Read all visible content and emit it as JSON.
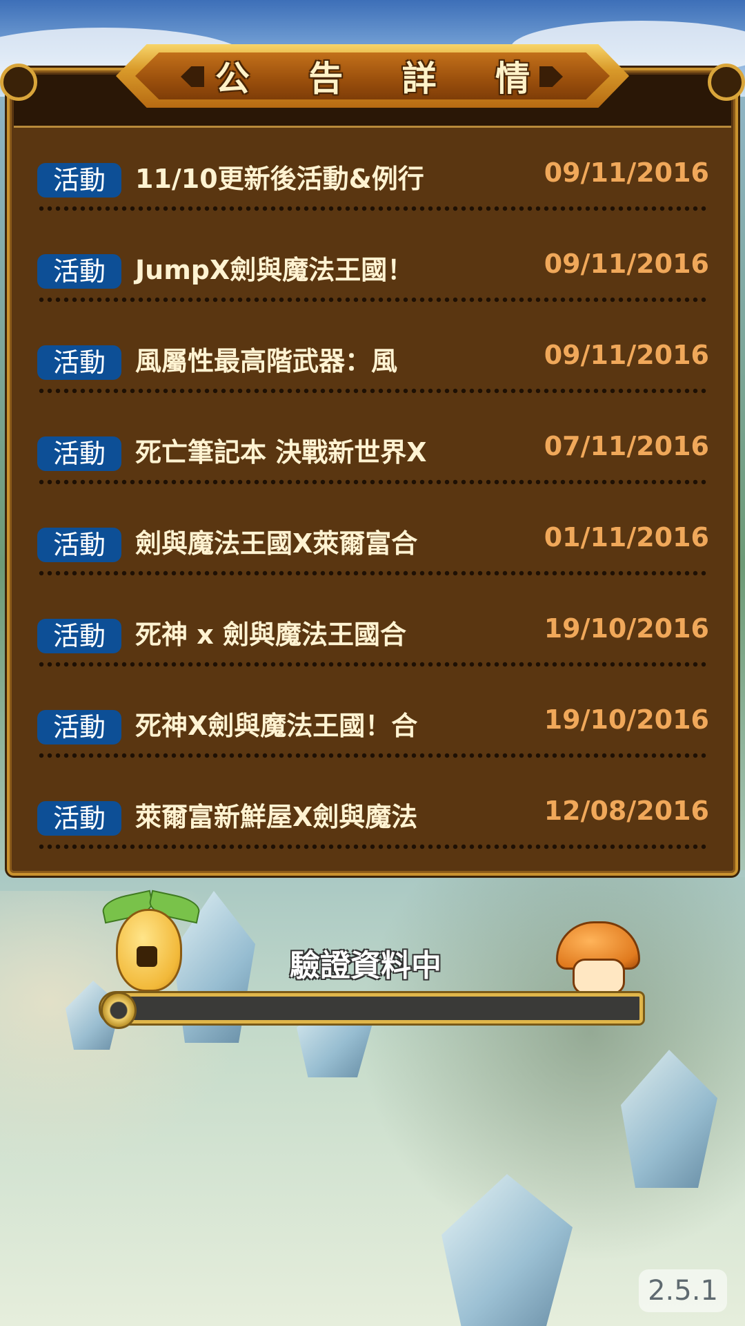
{
  "title": "公 告 詳 情",
  "announcements": [
    {
      "tag": "活動",
      "title": "11/10更新後活動&例行",
      "date": "09/11/2016"
    },
    {
      "tag": "活動",
      "title": "JumpX劍與魔法王國！",
      "date": "09/11/2016"
    },
    {
      "tag": "活動",
      "title": "風屬性最高階武器：風",
      "date": "09/11/2016"
    },
    {
      "tag": "活動",
      "title": "死亡筆記本 決戰新世界X",
      "date": "07/11/2016"
    },
    {
      "tag": "活動",
      "title": "劍與魔法王國X萊爾富合",
      "date": "01/11/2016"
    },
    {
      "tag": "活動",
      "title": "死神 x 劍與魔法王國合",
      "date": "19/10/2016"
    },
    {
      "tag": "活動",
      "title": "死神X劍與魔法王國！合",
      "date": "19/10/2016"
    },
    {
      "tag": "活動",
      "title": "萊爾富新鮮屋X劍與魔法",
      "date": "12/08/2016"
    }
  ],
  "loading": {
    "label": "驗證資料中",
    "progress": 0
  },
  "version": "2.5.1",
  "colors": {
    "panel_bg": "#5a3611",
    "tag_bg": "#0d4f96",
    "date_text": "#f0a85a",
    "title_text": "#fff3d2"
  }
}
